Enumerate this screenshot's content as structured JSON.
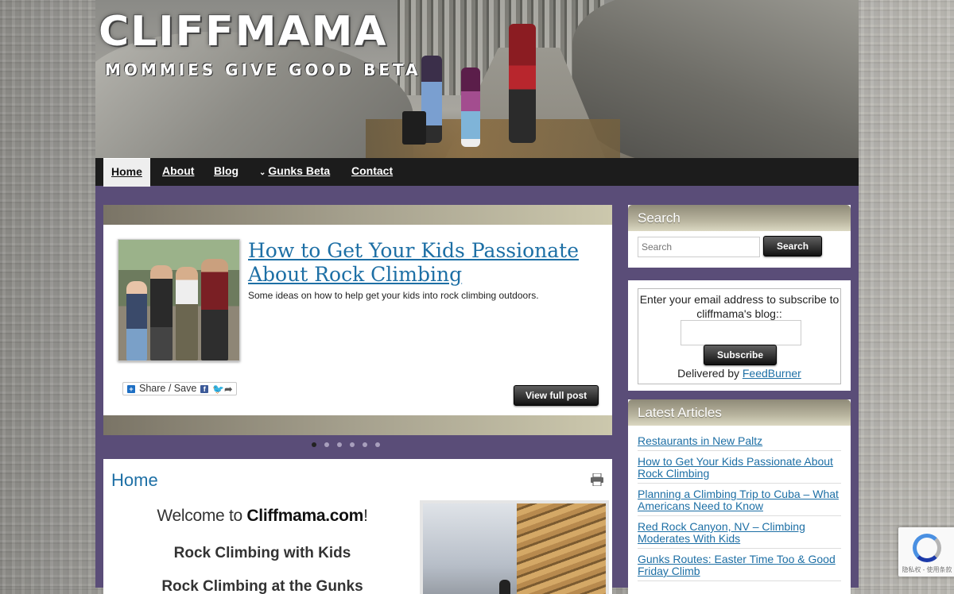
{
  "site": {
    "title": "CLIFFMAMA",
    "tagline": "MOMMIES GIVE GOOD BETA"
  },
  "nav": {
    "items": [
      {
        "label": "Home",
        "active": true
      },
      {
        "label": "About"
      },
      {
        "label": "Blog"
      },
      {
        "label": "Gunks Beta",
        "has_dropdown": true
      },
      {
        "label": "Contact"
      }
    ]
  },
  "featured": {
    "title": "How to Get Your Kids Passionate About Rock Climbing",
    "description": "Some ideas on how to help get your kids into rock climbing outdoors.",
    "share_label": "Share / Save",
    "view_full_label": "View full post",
    "slide_count": 6,
    "active_slide": 1
  },
  "home": {
    "title": "Home",
    "welcome_prefix": "Welcome to ",
    "welcome_site": "Cliffmama.com",
    "welcome_suffix": "!",
    "subheading1": "Rock Climbing with Kids",
    "subheading2": "Rock Climbing at the Gunks"
  },
  "sidebar": {
    "search": {
      "heading": "Search",
      "placeholder": "Search",
      "button_label": "Search"
    },
    "subscribe": {
      "text": "Enter your email address to subscribe to cliffmama's blog::",
      "button_label": "Subscribe",
      "delivered_by": "Delivered by ",
      "feedburner": "FeedBurner"
    },
    "latest": {
      "heading": "Latest Articles",
      "items": [
        "Restaurants in New Paltz",
        "How to Get Your Kids Passionate About Rock Climbing",
        "Planning a Climbing Trip to Cuba – What Americans Need to Know",
        "Red Rock Canyon, NV – Climbing Moderates With Kids",
        "Gunks Routes: Easter Time Too & Good Friday Climb"
      ]
    }
  },
  "recaptcha": {
    "text": "隐私权 - 使用条款"
  }
}
